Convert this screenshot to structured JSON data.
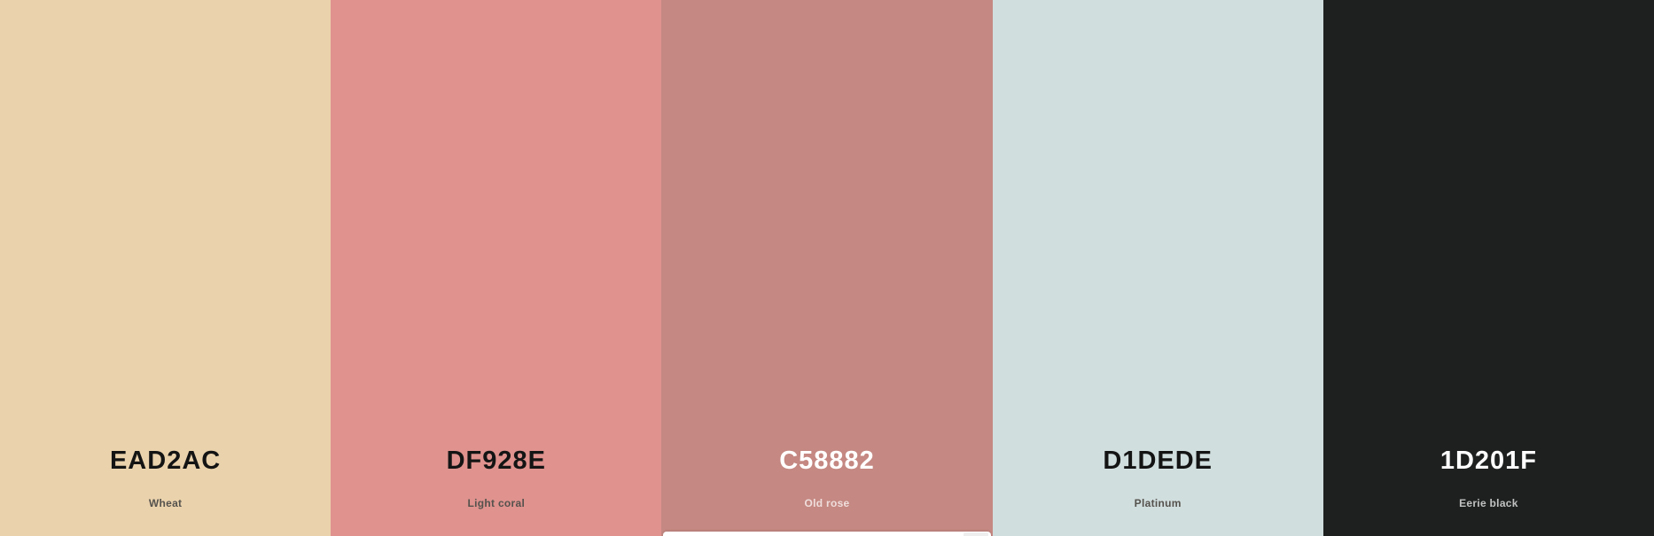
{
  "palette": {
    "colors": [
      {
        "hex": "EAD2AC",
        "name": "Wheat",
        "color": "#EAD2AC",
        "text_tone": "dark"
      },
      {
        "hex": "DF928E",
        "name": "Light coral",
        "color": "#DF928E",
        "text_tone": "dark"
      },
      {
        "hex": "C58882",
        "name": "Old rose",
        "color": "#C58882",
        "text_tone": "light"
      },
      {
        "hex": "D1DEDE",
        "name": "Platinum",
        "color": "#D1DEDE",
        "text_tone": "dark"
      },
      {
        "hex": "1D201F",
        "name": "Eerie black",
        "color": "#1D201F",
        "text_tone": "light"
      }
    ]
  }
}
